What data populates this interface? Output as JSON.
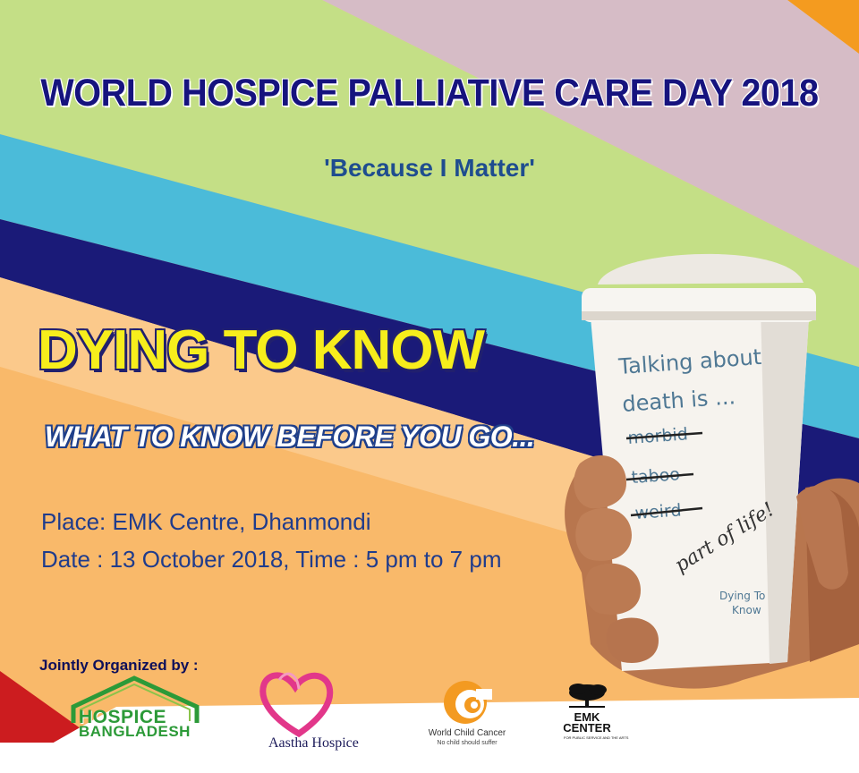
{
  "header": {
    "title": "WORLD HOSPICE PALLIATIVE CARE DAY 2018",
    "tagline": "'Because I Matter'"
  },
  "event": {
    "headline": "DYING TO KNOW",
    "subheadline": "WHAT TO KNOW BEFORE YOU GO...",
    "place": "Place: EMK Centre, Dhanmondi",
    "datetime": "Date : 13 October 2018, Time : 5 pm to 7 pm"
  },
  "cup": {
    "line1": "Talking about",
    "line2": "death is ...",
    "crossed": [
      "morbid",
      "taboo",
      "weird"
    ],
    "handwritten": "part of life!",
    "brand_line1": "Dying To",
    "brand_line2": "Know"
  },
  "organizers": {
    "label": "Jointly Organized by :",
    "logos": [
      {
        "name_line1": "HOSPICE",
        "name_line2": "BANGLADESH"
      },
      {
        "name": "Aastha Hospice"
      },
      {
        "name": "World Child Cancer",
        "tagline": "No child should suffer"
      },
      {
        "name_line1": "EMK",
        "name_line2": "CENTER",
        "tagline": "FOR PUBLIC SERVICE AND THE ARTS"
      }
    ]
  },
  "colors": {
    "stripe_orange": "#f49b1f",
    "stripe_mauve": "#d6bcc6",
    "stripe_green": "#c4df86",
    "stripe_blue": "#4bbbd9",
    "stripe_navy": "#1a1a78",
    "stripe_peach": "#f9c37d",
    "stripe_red": "#cc1c1f",
    "title_navy": "#16137e",
    "headline_yellow": "#f7ee1c"
  }
}
